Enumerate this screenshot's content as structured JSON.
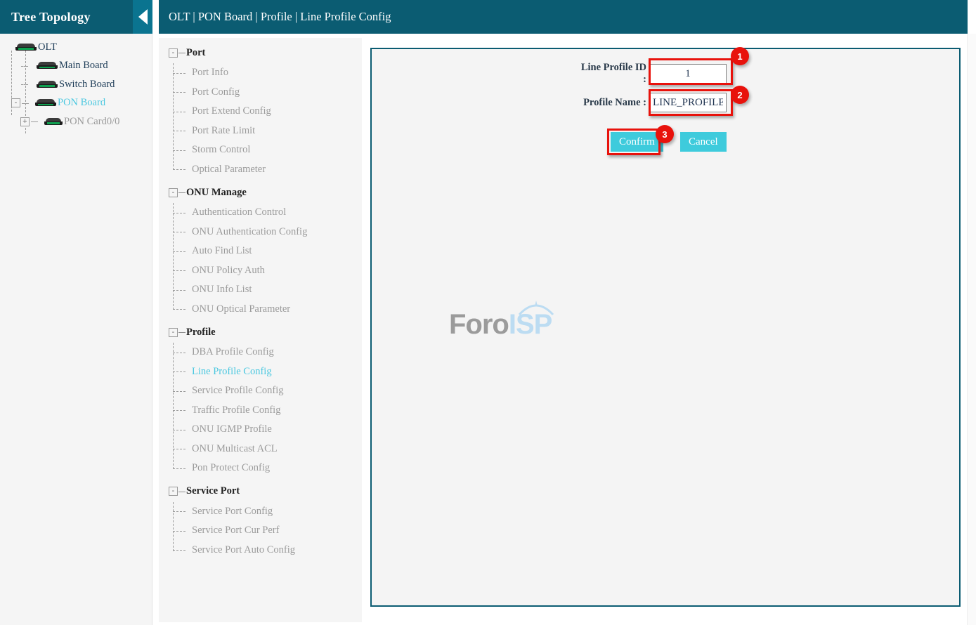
{
  "header": {
    "tree_title": "Tree Topology",
    "collapse_icon": "triangle-left-icon",
    "breadcrumb": "OLT | PON Board | Profile | Line Profile Config"
  },
  "tree": {
    "nodes": [
      {
        "label": "OLT",
        "state": "dark",
        "toggle": null,
        "icon": "device-board-icon"
      },
      {
        "label": "Main Board",
        "state": "dark",
        "toggle": null,
        "icon": "device-board-icon"
      },
      {
        "label": "Switch Board",
        "state": "dark",
        "toggle": null,
        "icon": "device-board-icon"
      },
      {
        "label": "PON Board",
        "state": "active",
        "toggle": "-",
        "icon": "device-board-icon"
      },
      {
        "label": "PON Card0/0",
        "state": "muted",
        "toggle": "+",
        "icon": "device-board-icon"
      }
    ]
  },
  "nav": {
    "groups": [
      {
        "name": "Port",
        "toggle": "-",
        "items": [
          {
            "label": "Port Info",
            "active": false
          },
          {
            "label": "Port Config",
            "active": false
          },
          {
            "label": "Port Extend Config",
            "active": false
          },
          {
            "label": "Port Rate Limit",
            "active": false
          },
          {
            "label": "Storm Control",
            "active": false
          },
          {
            "label": "Optical Parameter",
            "active": false
          }
        ]
      },
      {
        "name": "ONU Manage",
        "toggle": "-",
        "items": [
          {
            "label": "Authentication Control",
            "active": false
          },
          {
            "label": "ONU Authentication Config",
            "active": false
          },
          {
            "label": "Auto Find List",
            "active": false
          },
          {
            "label": "ONU Policy Auth",
            "active": false
          },
          {
            "label": "ONU Info List",
            "active": false
          },
          {
            "label": "ONU Optical Parameter",
            "active": false
          }
        ]
      },
      {
        "name": "Profile",
        "toggle": "-",
        "items": [
          {
            "label": "DBA Profile Config",
            "active": false
          },
          {
            "label": "Line Profile Config",
            "active": true
          },
          {
            "label": "Service Profile Config",
            "active": false
          },
          {
            "label": "Traffic Profile Config",
            "active": false
          },
          {
            "label": "ONU IGMP Profile",
            "active": false
          },
          {
            "label": "ONU Multicast ACL",
            "active": false
          },
          {
            "label": "Pon Protect Config",
            "active": false
          }
        ]
      },
      {
        "name": "Service Port",
        "toggle": "-",
        "items": [
          {
            "label": "Service Port Config",
            "active": false
          },
          {
            "label": "Service Port Cur Perf",
            "active": false
          },
          {
            "label": "Service Port Auto Config",
            "active": false
          }
        ]
      }
    ]
  },
  "form": {
    "line_profile_id_label": "Line Profile ID  :",
    "line_profile_id_value": "1",
    "profile_name_label": "Profile Name  :",
    "profile_name_value": "LINE_PROFILE",
    "confirm_label": "Confirm",
    "cancel_label": "Cancel"
  },
  "annotations": {
    "badge_1": "1",
    "badge_2": "2",
    "badge_3": "3"
  },
  "watermark": {
    "part1": "Foro",
    "part2": "ISP"
  },
  "colors": {
    "header_teal": "#0b5c72",
    "collapse_teal": "#0a7490",
    "accent_cyan": "#4bc8e0",
    "button_cyan": "#3ecbdc",
    "highlight_red": "#e8120c",
    "panel_gray": "#f5f5f5"
  }
}
